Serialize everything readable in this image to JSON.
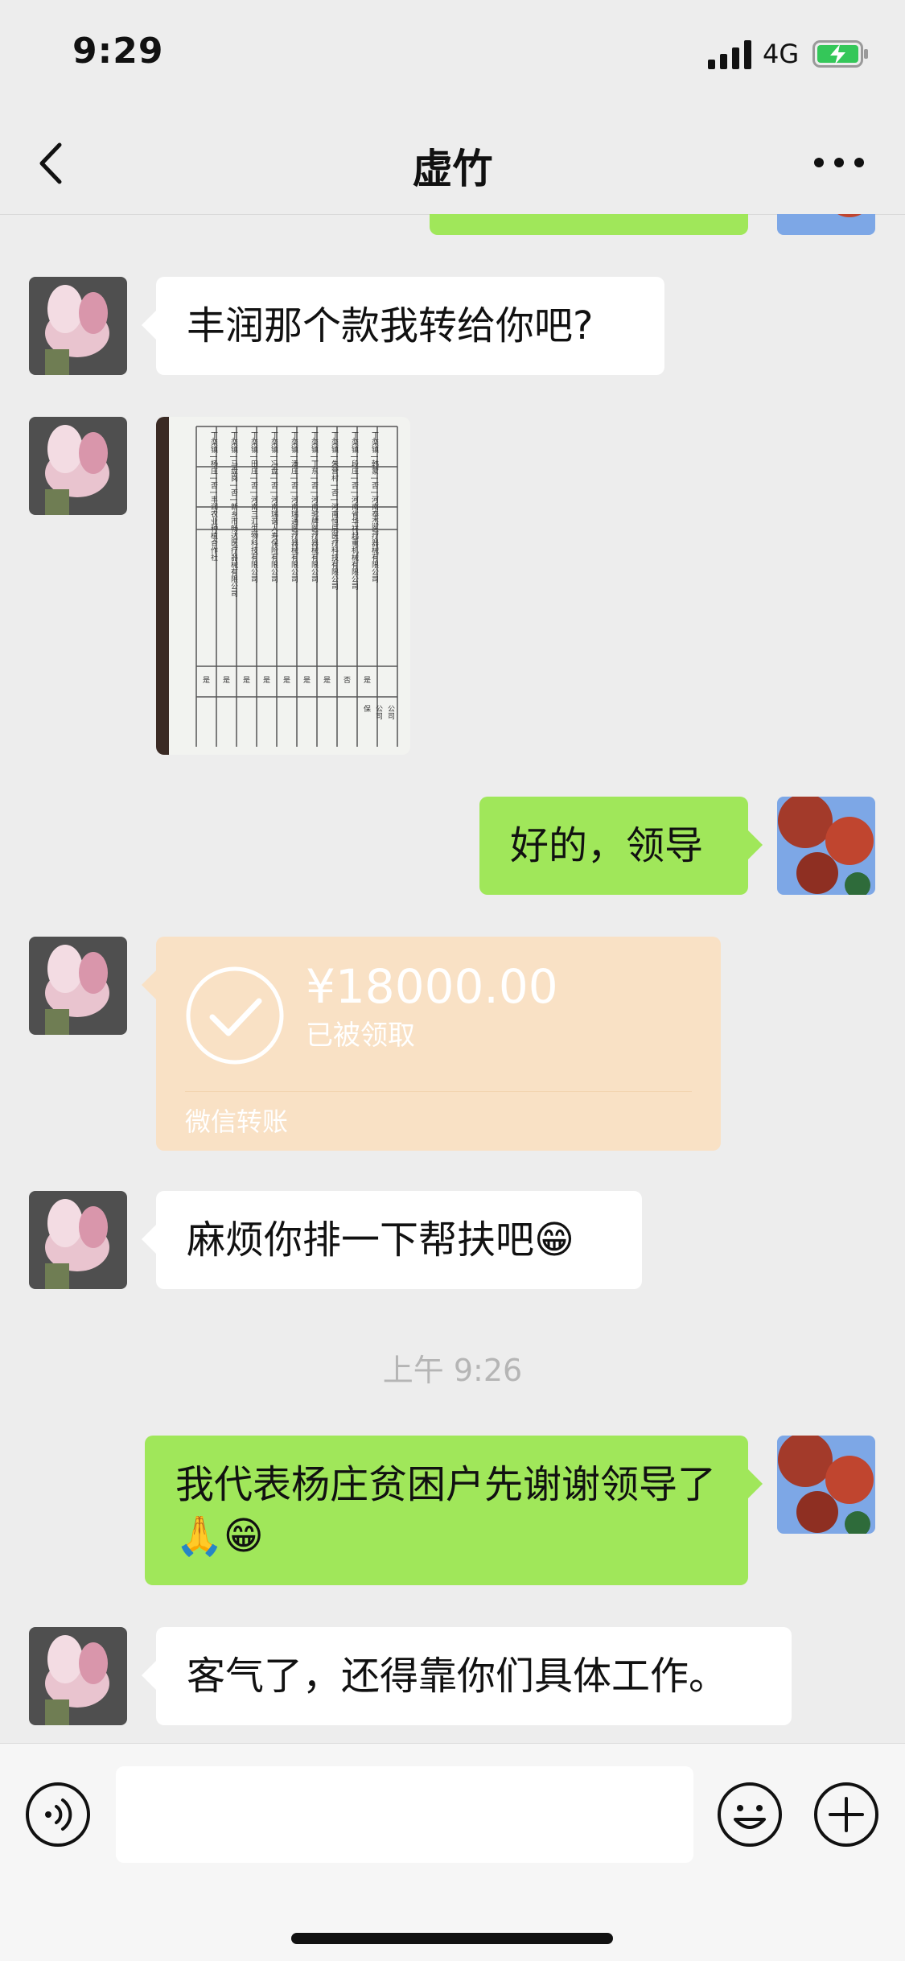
{
  "status": {
    "time": "9:29",
    "network": "4G"
  },
  "header": {
    "title": "虚竹"
  },
  "messages": {
    "m1": "丰润那个款我转给你吧?",
    "m3": "好的，领导",
    "transfer": {
      "amount": "¥18000.00",
      "status": "已被领取",
      "label": "微信转账"
    },
    "m5": "麻烦你排一下帮扶吧😁",
    "timestamp": "上午 9:26",
    "m6": "我代表杨庄贫困户先谢谢领导了🙏😁",
    "m7": "客气了，还得靠你们具体工作。"
  },
  "document_image": {
    "rows": [
      "丁栾镇 | 韩蒙 | 否 | 河南泰杰医疗器械有限公司",
      "丁栾镇 | 段庄 | 否 | 河南省华祥起重机械有限公司",
      "丁栾镇 | 朱营村 | 否 | 河南恒辰医疗科技有限公司",
      "丁栾镇 | 丁东 | 否 | 河南驼牌医疗器械有限公司",
      "丁栾镇 | 潘庄 | 否 | 河南瑞通医疗器械有限公司",
      "丁栾镇 | 冯盘 | 否 | 河南瑞谐人寿保险有限公司",
      "丁栾镇 | 田庄 | 否 | 河南三汇生物科技有限公司",
      "丁栾镇 | 马盘岗 | 否 | 新乡市畅达医疗器械有限公司",
      "丁栾镇 | 杨庄 | 否 | 丰润农业种植合作社"
    ],
    "right_col": [
      "是",
      "否",
      "是",
      "是",
      "是",
      "是",
      "是",
      "是",
      "是"
    ],
    "edge_text": [
      "公司",
      "公司",
      "保"
    ]
  },
  "icons": {
    "back": "chevron-left-icon",
    "more": "more-dots-icon",
    "voice": "voice-icon",
    "emoji": "emoji-icon",
    "plus": "plus-icon",
    "check": "check-icon",
    "signal": "signal-icon",
    "battery": "battery-charging-icon"
  },
  "colors": {
    "bubble_self": "#a0e75a",
    "transfer_bg": "#f9e1c5",
    "background": "#ededed"
  }
}
